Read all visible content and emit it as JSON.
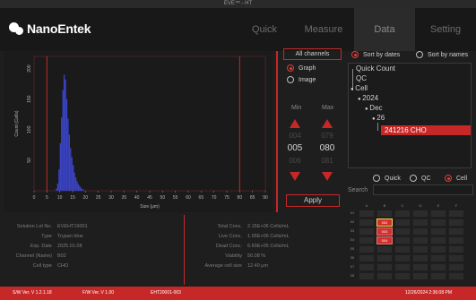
{
  "window": {
    "title": "EVE™ - HT"
  },
  "brand": {
    "name": "NanoEntek"
  },
  "nav": {
    "tabs": [
      {
        "label": "Quick"
      },
      {
        "label": "Measure"
      },
      {
        "label": "Data"
      },
      {
        "label": "Setting"
      }
    ]
  },
  "controls": {
    "all_channels": "All channels",
    "graph_label": "Graph",
    "image_label": "Image",
    "min_label": "Min",
    "max_label": "Max",
    "min_values": [
      "004",
      "005",
      "006"
    ],
    "max_values": [
      "079",
      "080",
      "081"
    ],
    "apply": "Apply"
  },
  "sort": {
    "by_dates": "Sort by dates",
    "by_names": "Sort by names"
  },
  "tree": {
    "quick_count": "Quick Count",
    "qc": "QC",
    "cell": "Cell",
    "year": "2024",
    "month": "Dec",
    "day": "26",
    "selected": "241216 CHO"
  },
  "filter": {
    "quick": "Quick",
    "qc": "QC",
    "cell": "Cell"
  },
  "search": {
    "label": "Search",
    "value": ""
  },
  "plate": {
    "cols": [
      "A",
      "B",
      "C",
      "D",
      "E",
      "F"
    ],
    "rows": [
      "01",
      "02",
      "03",
      "04",
      "05",
      "06",
      "07",
      "08"
    ],
    "highlight": [
      {
        "row": 1,
        "col": 1,
        "label": "002"
      },
      {
        "row": 2,
        "col": 1,
        "label": "003"
      },
      {
        "row": 3,
        "col": 1,
        "label": "004"
      }
    ]
  },
  "info_left": [
    {
      "label": "Solution Lot No.",
      "value": "EVEHT19001"
    },
    {
      "label": "Type",
      "value": "Trypan blue"
    },
    {
      "label": "Exp. Date",
      "value": "2025.01.08"
    },
    {
      "label": "Channel (Name)",
      "value": "B02"
    },
    {
      "label": "Cell type",
      "value": "CHO"
    }
  ],
  "info_right": [
    {
      "label": "Total Conc.",
      "value": "2.15E+06 Cells/mL"
    },
    {
      "label": "Live Conc.",
      "value": "1.55E+06 Cells/mL"
    },
    {
      "label": "Dead Conc.",
      "value": "6.60E+05 Cells/mL"
    },
    {
      "label": "Viability",
      "value": "50.08 %"
    },
    {
      "label": "Average cell size",
      "value": "12.40 μm"
    }
  ],
  "status": {
    "sw": "S/W Ver. V 1.2.1.18",
    "fw": "F/W Ver. V 1.00",
    "device": "EHT20001-003",
    "datetime": "12/26/2024 2:36:08 PM"
  },
  "chart_data": {
    "type": "bar",
    "xlabel": "Size (μm)",
    "ylabel": "Count (Cells)",
    "xlim": [
      0,
      90
    ],
    "ylim": [
      0,
      220
    ],
    "xticks": [
      0,
      5,
      10,
      15,
      20,
      25,
      30,
      35,
      40,
      45,
      50,
      55,
      60,
      65,
      70,
      75,
      80,
      85,
      90
    ],
    "yticks": [
      50,
      100,
      150,
      200
    ],
    "gate_min": 5,
    "gate_max": 80,
    "bin_width": 0.5,
    "bar_color": "#3b45c9",
    "gate_color": "#c62828",
    "x": [
      8.5,
      9.0,
      9.5,
      10.0,
      10.5,
      11.0,
      11.5,
      12.0,
      12.5,
      13.0,
      13.5,
      14.0,
      14.5,
      15.0,
      15.5,
      16.0,
      16.5,
      17.0,
      17.5,
      18.0,
      18.5,
      19.0
    ],
    "values": [
      4,
      12,
      35,
      78,
      120,
      165,
      190,
      182,
      150,
      118,
      92,
      70,
      55,
      42,
      30,
      22,
      16,
      11,
      8,
      5,
      3,
      2
    ]
  }
}
